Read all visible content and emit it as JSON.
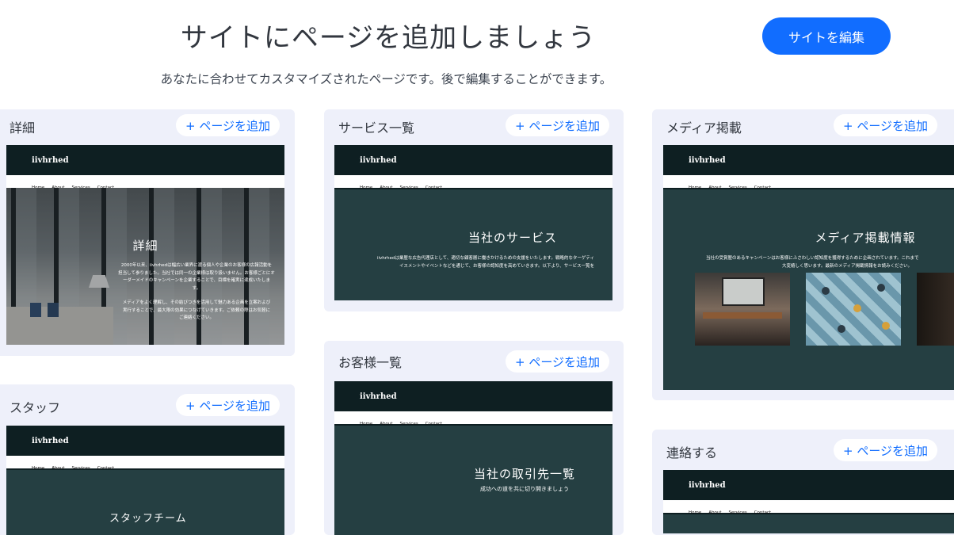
{
  "header": {
    "title": "サイトにページを追加しましょう",
    "subtitle": "あなたに合わせてカスタマイズされたページです。後で編集することができます。",
    "edit_button": "サイトを編集"
  },
  "add_label": "+ ページを追加",
  "preview_common": {
    "logo": "iivhrhed",
    "nav": [
      "Home",
      "About",
      "Services",
      "Contact"
    ]
  },
  "cards": {
    "details": {
      "title": "詳細",
      "heading": "詳細",
      "body_lines": [
        "2000年以来、iivhrhedは幅広い業界に渡る個人や企業のお客様の広報活動を",
        "担当して参りました。当社では同一の企業様は取り扱いません。お客様ごとにオ",
        "ーダーメイドのキャンペーンを企業することで、目標を確実に達成いたしま",
        "す。",
        "",
        "メディアをよく理解し、その結びつきを活用して魅力ある企画を立案および",
        "実行することで、最大限の効果につなげていきます。ご依頼の際はお気軽に",
        "ご連絡ください。"
      ]
    },
    "services": {
      "title": "サービス一覧",
      "heading": "当社のサービス",
      "body_lines": [
        "iivhrhedは業歴な広告代理店として、適切な顧客層に働きかけるための支援をいたします。戦略的なターゲティ",
        "イスメントやイベントなどを通じて、お客様の認知度を高めていきます。以下より、サービス一覧を"
      ]
    },
    "media": {
      "title": "メディア掲載",
      "heading": "メディア掲載情報",
      "body_lines": [
        "当社の受賞歴のあるキャンペーンはお客様にふさわしい認知度を獲得するために企画されています。これまで",
        "大変嬉しく思います。最新のメディア掲載情報をお読みください。"
      ]
    },
    "clients": {
      "title": "お客様一覧",
      "heading": "当社の取引先一覧",
      "sub": "成功への道を共に切り開きましょう"
    },
    "staff": {
      "title": "スタッフ",
      "heading": "スタッフチーム"
    },
    "contact": {
      "title": "連絡する"
    }
  }
}
